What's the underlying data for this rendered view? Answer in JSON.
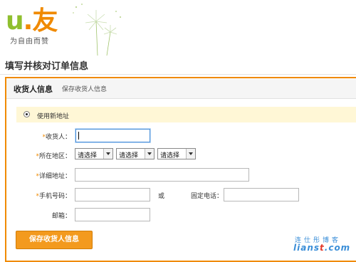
{
  "header": {
    "logo_mark": "u",
    "logo_dot": ".",
    "logo_char": "友",
    "tagline": "为自由而赞",
    "page_title": "填写并核对订单信息"
  },
  "panel": {
    "title": "收货人信息",
    "subtab": "保存收货人信息",
    "new_address_label": "使用新地址",
    "new_address_selected": true,
    "fields": {
      "consignee_label": "收货人：",
      "region_label": "所在地区：",
      "region_selects": [
        "请选择",
        "请选择",
        "请选择"
      ],
      "address_label": "详细地址：",
      "mobile_label": "手机号码：",
      "or_label": "或",
      "phone_label": "固定电话：",
      "email_label": "邮箱："
    },
    "save_button": "保存收货人信息"
  },
  "watermark": {
    "top": "连仕彤博客",
    "text_blue": "lians",
    "text_red": "t",
    "text_blue2": ".com"
  },
  "colors": {
    "accent": "#f08a00",
    "highlight_bar": "#fff7d6",
    "focus": "#4a90d9"
  }
}
